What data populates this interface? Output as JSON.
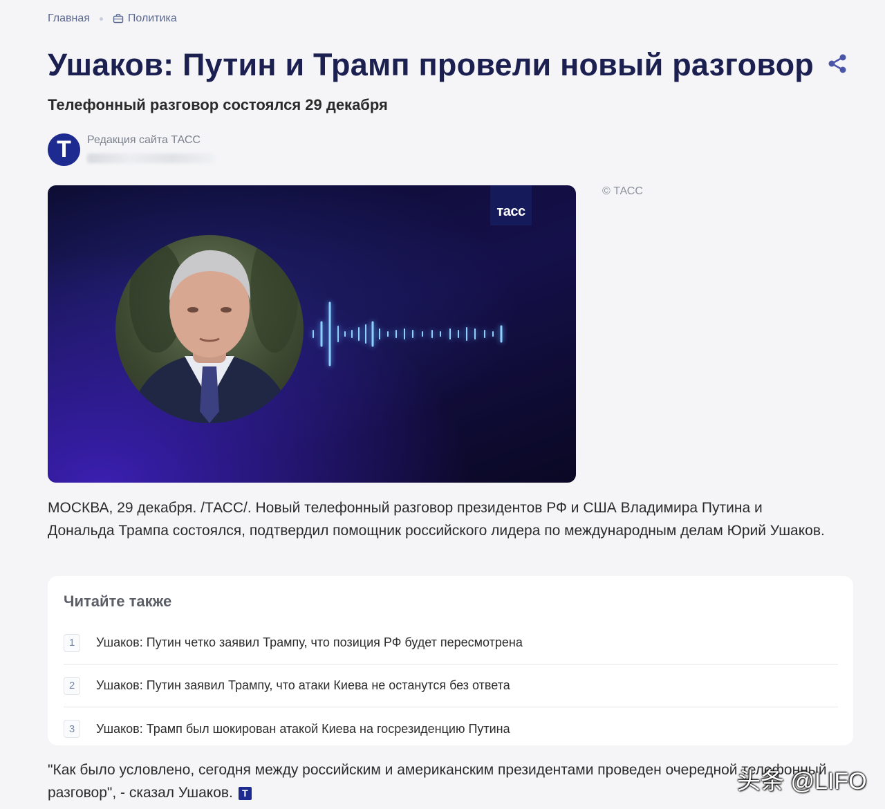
{
  "breadcrumb": {
    "home": "Главная",
    "section": "Политика",
    "section_icon": "briefcase-icon"
  },
  "article": {
    "title": "Ушаков: Путин и Трамп провели новый разговор",
    "subtitle": "Телефонный разговор состоялся 29 декабря",
    "author_initial": "T",
    "author": "Редакция сайта ТАСС",
    "media_badge": "тасс",
    "credit": "© ТАСС",
    "lead": "МОСКВА, 29 декабря. /ТАСС/. Новый телефонный разговор президентов РФ и США Владимира Путина и Дональда Трампа состоялся, подтвердил помощник российского лидера по международным делам Юрий Ушаков.",
    "quote": "\"Как было условлено, сегодня между российским и американским президентами проведен очередной телефонный разговор\", - сказал Ушаков.",
    "end_mark": "T"
  },
  "read_also": {
    "title": "Читайте также",
    "items": [
      {
        "num": "1",
        "text": "Ушаков: Путин четко заявил Трампу, что позиция РФ будет пересмотрена"
      },
      {
        "num": "2",
        "text": "Ушаков: Путин заявил Трампу, что атаки Киева не останутся без ответа"
      },
      {
        "num": "3",
        "text": "Ушаков: Трамп был шокирован атакой Киева на госрезиденцию Путина"
      }
    ]
  },
  "watermark": "头条 @LIFO",
  "colors": {
    "title": "#1b2050",
    "brand": "#1d2a8f",
    "share": "#4a55a8"
  }
}
